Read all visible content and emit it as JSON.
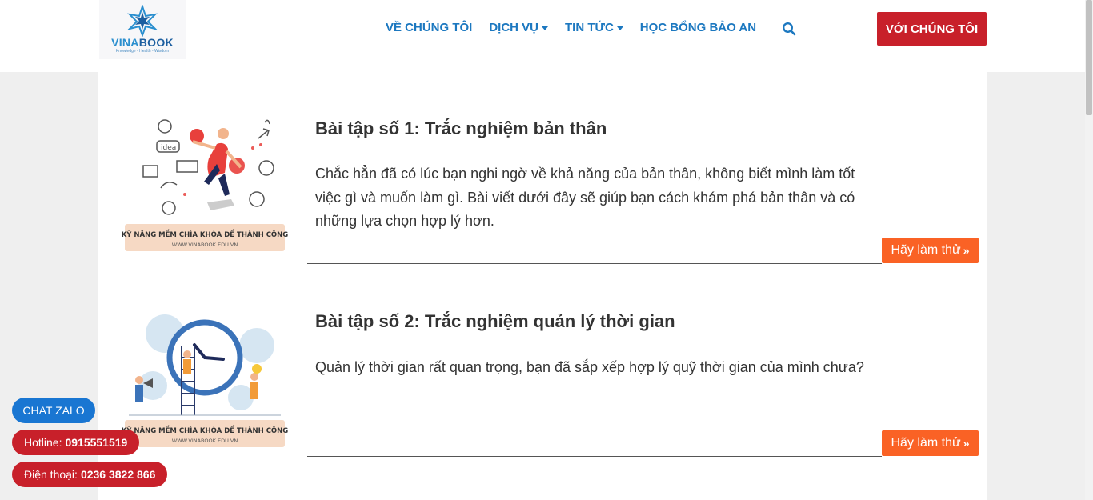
{
  "header": {
    "logo": {
      "name": "VINABOOK",
      "name_part1": "VINA",
      "name_part2": "BOOK",
      "tagline": "Knowledge - Health - Wisdom"
    },
    "nav": [
      {
        "label": "VỀ CHÚNG TÔI",
        "dropdown": false
      },
      {
        "label": "DỊCH VỤ",
        "dropdown": true
      },
      {
        "label": "TIN TỨC",
        "dropdown": true
      },
      {
        "label": "HỌC BỔNG BẢO AN",
        "dropdown": false
      }
    ],
    "search_icon": "search-icon",
    "cta_label": "VỚI CHÚNG TÔI"
  },
  "articles": [
    {
      "title": "Bài tập số 1: Trắc nghiệm bản thân",
      "description": "Chắc hẳn đã có lúc bạn nghi ngờ về khả năng của bản thân, không biết mình làm tốt việc gì và muốn làm gì. Bài viết dưới đây sẽ giúp bạn cách khám phá bản thân và có những lựa chọn hợp lý hơn.",
      "button_label": "Hãy làm thử",
      "image_caption": "KỸ NĂNG MỀM CHÌA KHÓA ĐỂ THÀNH CÔNG",
      "image_url_text": "WWW.VINABOOK.EDU.VN",
      "image_word": "idea"
    },
    {
      "title": "Bài tập số 2: Trắc nghiệm quản lý thời gian",
      "description": "Quản lý thời gian rất quan trọng, bạn đã sắp xếp hợp lý quỹ thời gian của mình chưa?",
      "button_label": "Hãy làm thử",
      "image_caption": "KỸ NĂNG MỀM CHÌA KHÓA ĐỂ THÀNH CÔNG",
      "image_url_text": "WWW.VINABOOK.EDU.VN"
    }
  ],
  "floating": {
    "zalo": "CHAT ZALO",
    "hotline_label": "Hotline:",
    "hotline_number": "0915551519",
    "phone_label": "Điện thoại:",
    "phone_number": "0236 3822 866"
  },
  "colors": {
    "nav": "#1c78c0",
    "cta": "#c8202a",
    "try_button": "#fa6225",
    "zalo": "#1976d2",
    "background": "#efefef"
  }
}
